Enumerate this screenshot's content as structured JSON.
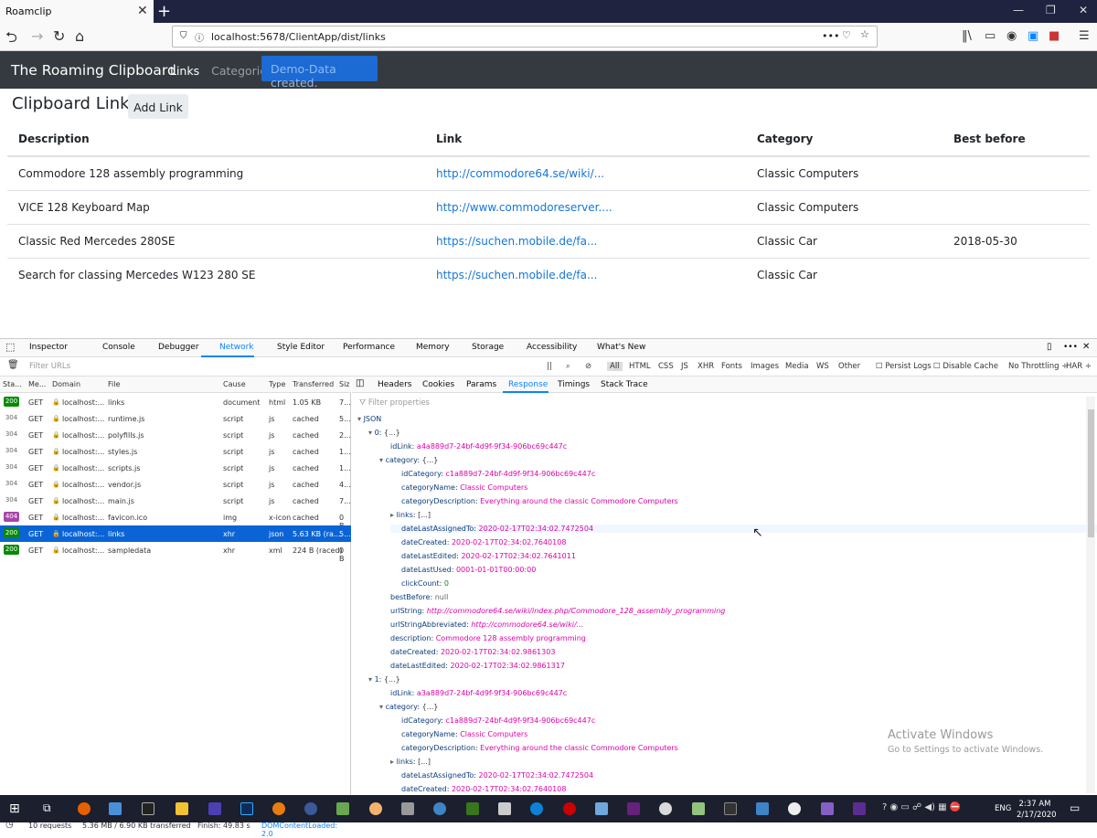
{
  "browser": {
    "tab_title": "Roamclip",
    "url": "localhost:5678/ClientApp/dist/links"
  },
  "app": {
    "brand": "The Roaming Clipboard",
    "nav_links": "Links",
    "nav_categories": "Categories",
    "alert": "Demo-Data created.",
    "page_title": "Clipboard Links",
    "add_button": "Add Link",
    "columns": [
      "Description",
      "Link",
      "Category",
      "Best before"
    ],
    "rows": [
      {
        "description": "Commodore 128 assembly programming",
        "link": "http://commodore64.se/wiki/...",
        "category": "Classic Computers",
        "best_before": ""
      },
      {
        "description": "VICE 128 Keyboard Map",
        "link": "http://www.commodoreserver....",
        "category": "Classic Computers",
        "best_before": ""
      },
      {
        "description": "Classic Red Mercedes 280SE",
        "link": "https://suchen.mobile.de/fa...",
        "category": "Classic Car",
        "best_before": "2018-05-30"
      },
      {
        "description": "Search for classing Mercedes W123 280 SE",
        "link": "https://suchen.mobile.de/fa...",
        "category": "Classic Car",
        "best_before": ""
      }
    ]
  },
  "devtools": {
    "tabs": [
      "Inspector",
      "Console",
      "Debugger",
      "Network",
      "Style Editor",
      "Performance",
      "Memory",
      "Storage",
      "Accessibility",
      "What's New"
    ],
    "filter_placeholder": "Filter URLs",
    "types": [
      "All",
      "HTML",
      "CSS",
      "JS",
      "XHR",
      "Fonts",
      "Images",
      "Media",
      "WS",
      "Other"
    ],
    "persist_logs": "Persist Logs",
    "disable_cache": "Disable Cache",
    "throttling": "No Throttling ÷",
    "har": "HAR ÷",
    "req_columns": [
      "Sta...",
      "Me...",
      "Domain",
      "File",
      "Cause",
      "Type",
      "Transferred",
      "Siz"
    ],
    "requests": [
      {
        "status": "200",
        "method": "GET",
        "domain": "localhost:...",
        "file": "links",
        "cause": "document",
        "type": "html",
        "transferred": "1.05 KB",
        "size": "7..."
      },
      {
        "status": "304",
        "method": "GET",
        "domain": "localhost:...",
        "file": "runtime.js",
        "cause": "script",
        "type": "js",
        "transferred": "cached",
        "size": "5..."
      },
      {
        "status": "304",
        "method": "GET",
        "domain": "localhost:...",
        "file": "polyfills.js",
        "cause": "script",
        "type": "js",
        "transferred": "cached",
        "size": "2..."
      },
      {
        "status": "304",
        "method": "GET",
        "domain": "localhost:...",
        "file": "styles.js",
        "cause": "script",
        "type": "js",
        "transferred": "cached",
        "size": "1..."
      },
      {
        "status": "304",
        "method": "GET",
        "domain": "localhost:...",
        "file": "scripts.js",
        "cause": "script",
        "type": "js",
        "transferred": "cached",
        "size": "1..."
      },
      {
        "status": "304",
        "method": "GET",
        "domain": "localhost:...",
        "file": "vendor.js",
        "cause": "script",
        "type": "js",
        "transferred": "cached",
        "size": "4..."
      },
      {
        "status": "304",
        "method": "GET",
        "domain": "localhost:...",
        "file": "main.js",
        "cause": "script",
        "type": "js",
        "transferred": "cached",
        "size": "7..."
      },
      {
        "status": "404",
        "method": "GET",
        "domain": "localhost:...",
        "file": "favicon.ico",
        "cause": "img",
        "type": "x-icon",
        "transferred": "cached",
        "size": "0 B"
      },
      {
        "status": "200",
        "method": "GET",
        "domain": "localhost:...",
        "file": "links",
        "cause": "xhr",
        "type": "json",
        "transferred": "5.63 KB (ra...",
        "size": "5..."
      },
      {
        "status": "200",
        "method": "GET",
        "domain": "localhost:...",
        "file": "sampledata",
        "cause": "xhr",
        "type": "xml",
        "transferred": "224 B (raced)",
        "size": "0 B"
      }
    ],
    "status_requests": "10 requests",
    "status_size": "5.36 MB / 6.90 KB transferred",
    "status_finish": "Finish: 49.83 s",
    "status_dcl": "DOMContentLoaded: 2.0",
    "detail_tabs": [
      "Headers",
      "Cookies",
      "Params",
      "Response",
      "Timings",
      "Stack Trace"
    ],
    "prop_filter": "Filter properties",
    "json_lines": [
      {
        "k": "JSON",
        "v": "",
        "cls": "jc"
      },
      {
        "k": "0: ",
        "v": "{...}",
        "cls": "jc"
      },
      {
        "k": "idLink: ",
        "v": "a4a889d7-24bf-4d9f-9f34-906bc69c447c",
        "cls": "jv"
      },
      {
        "k": "category: ",
        "v": "{...}",
        "cls": "jc"
      },
      {
        "k": "idCategory: ",
        "v": "c1a889d7-24bf-4d9f-9f34-906bc69c447c",
        "cls": "jv"
      },
      {
        "k": "categoryName: ",
        "v": "Classic Computers",
        "cls": "jv"
      },
      {
        "k": "categoryDescription: ",
        "v": "Everything around the classic Commodore Computers",
        "cls": "jv"
      },
      {
        "k": "links: ",
        "v": "[...]",
        "cls": "jc"
      },
      {
        "k": "dateLastAssignedTo: ",
        "v": "2020-02-17T02:34:02.7472504",
        "cls": "jv"
      },
      {
        "k": "dateCreated: ",
        "v": "2020-02-17T02:34:02.7640108",
        "cls": "jv"
      },
      {
        "k": "dateLastEdited: ",
        "v": "2020-02-17T02:34:02.7641011",
        "cls": "jv"
      },
      {
        "k": "dateLastUsed: ",
        "v": "0001-01-01T00:00:00",
        "cls": "jv"
      },
      {
        "k": "clickCount: ",
        "v": "0",
        "cls": "jn"
      },
      {
        "k": "bestBefore: ",
        "v": "null",
        "cls": "jnull"
      },
      {
        "k": "urlString: ",
        "v": "http://commodore64.se/wiki/index.php/Commodore_128_assembly_programming",
        "cls": "jv"
      },
      {
        "k": "urlStringAbbreviated: ",
        "v": "http://commodore64.se/wiki/...",
        "cls": "jv"
      },
      {
        "k": "description: ",
        "v": "Commodore 128 assembly programming",
        "cls": "jv"
      },
      {
        "k": "dateCreated: ",
        "v": "2020-02-17T02:34:02.9861303",
        "cls": "jv"
      },
      {
        "k": "dateLastEdited: ",
        "v": "2020-02-17T02:34:02.9861317",
        "cls": "jv"
      },
      {
        "k": "1: ",
        "v": "{...}",
        "cls": "jc"
      },
      {
        "k": "idLink: ",
        "v": "a3a889d7-24bf-4d9f-9f34-906bc69c447c",
        "cls": "jv"
      },
      {
        "k": "category: ",
        "v": "{...}",
        "cls": "jc"
      },
      {
        "k": "idCategory: ",
        "v": "c1a889d7-24bf-4d9f-9f34-906bc69c447c",
        "cls": "jv"
      },
      {
        "k": "categoryName: ",
        "v": "Classic Computers",
        "cls": "jv"
      },
      {
        "k": "categoryDescription: ",
        "v": "Everything around the classic Commodore Computers",
        "cls": "jv"
      },
      {
        "k": "links: ",
        "v": "[...]",
        "cls": "jc"
      },
      {
        "k": "dateLastAssignedTo: ",
        "v": "2020-02-17T02:34:02.7472504",
        "cls": "jv"
      },
      {
        "k": "dateCreated: ",
        "v": "2020-02-17T02:34:02.7640108",
        "cls": "jv"
      }
    ]
  },
  "watermark": {
    "title": "Activate Windows",
    "sub": "Go to Settings to activate Windows."
  },
  "taskbar": {
    "lang": "ENG",
    "time": "2:37 AM",
    "date": "2/17/2020"
  }
}
